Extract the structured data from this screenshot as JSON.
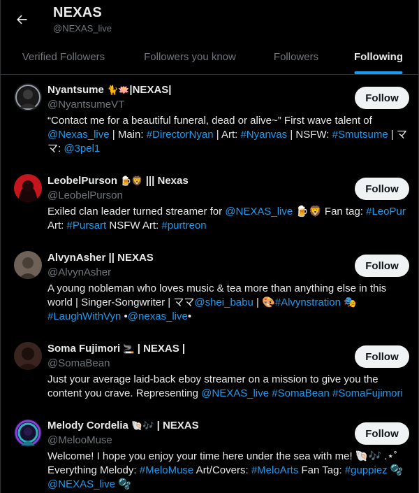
{
  "header": {
    "title": "NEXAS",
    "handle": "@NEXAS_live",
    "back_icon": "arrow-left-icon"
  },
  "tabs": [
    {
      "label": "Verified Followers",
      "active": false
    },
    {
      "label": "Followers you know",
      "active": false
    },
    {
      "label": "Followers",
      "active": false
    },
    {
      "label": "Following",
      "active": true
    }
  ],
  "accent_color": "#1d9bf0",
  "follow_label": "Follow",
  "users": [
    {
      "name_text": "Nyantsume",
      "name_emoji": "🐈🪷",
      "name_suffix": "|NEXAS|",
      "handle": "@NyantsumeVT",
      "bio": {
        "t1": "“Contact me for a beautiful funeral, dead or alive~” First wave talent of ",
        "l1": "@Nexas_live",
        "t2": " | Main: ",
        "l2": "#DirectorNyan",
        "t3": " | Art: ",
        "l3": "#Nyanvas",
        "t4": " | NSFW: ",
        "l4": "#Smutsume",
        "t5": " | ママ: ",
        "l5": "@3pel1"
      }
    },
    {
      "name_text": "LeobelPurson",
      "name_emoji": "🍺🦁",
      "name_suffix": "||| Nexas",
      "handle": "@LeobelPurson",
      "bio": {
        "t1": "Exiled clan leader turned streamer for ",
        "l1": "@NEXAS_live",
        "t2": " 🍺🦁 Fan tag: ",
        "l2": "#LeoPur",
        "t3": " Art: ",
        "l3": "#Pursart",
        "t4": " NSFW Art: ",
        "l4": "#purtreon"
      }
    },
    {
      "name_text": "AlvynAsher",
      "name_emoji": "",
      "name_suffix": "|| NEXAS",
      "handle": "@AlvynAsher",
      "bio": {
        "t1": "A young nobleman who loves music & tea more than anything else in this world | Singer-Songwriter | ママ",
        "l1": "@shei_babu",
        "t2": " | 🎨",
        "l2": "#Alvynstration",
        "t3": " 🎭 ",
        "l3": "#LaughWithVyn",
        "t4": " •",
        "l4": "@nexas_live",
        "t5": "•"
      }
    },
    {
      "name_text": "Soma Fujimori",
      "name_emoji": "🚬",
      "name_suffix": "| NEXAS |",
      "handle": "@SomaBean",
      "bio": {
        "t1": "Just your average laid-back eboy streamer on a mission to give you the content you crave. Representing ",
        "l1": "@NEXAS_live",
        "t2": " ",
        "l2": "#SomaBean",
        "t3": " ",
        "l3": "#SomaFujimori"
      }
    },
    {
      "name_text": "Melody Cordelia",
      "name_emoji": "🐚🎶",
      "name_suffix": "| NEXAS",
      "handle": "@MelooMuse",
      "bio": {
        "t1": "Welcome! I hope you enjoy your time here under the sea with me! 🐚🎶 .⋆˚ Everything Melody: ",
        "l1": "#MeloMuse",
        "t2": " Art/Covers: ",
        "l2": "#MeloArts",
        "t3": " Fan Tag: ",
        "l3": "#guppiez",
        "t4": " 🫧 ",
        "l4": "@NEXAS_live",
        "t5": " 🫧"
      }
    }
  ]
}
